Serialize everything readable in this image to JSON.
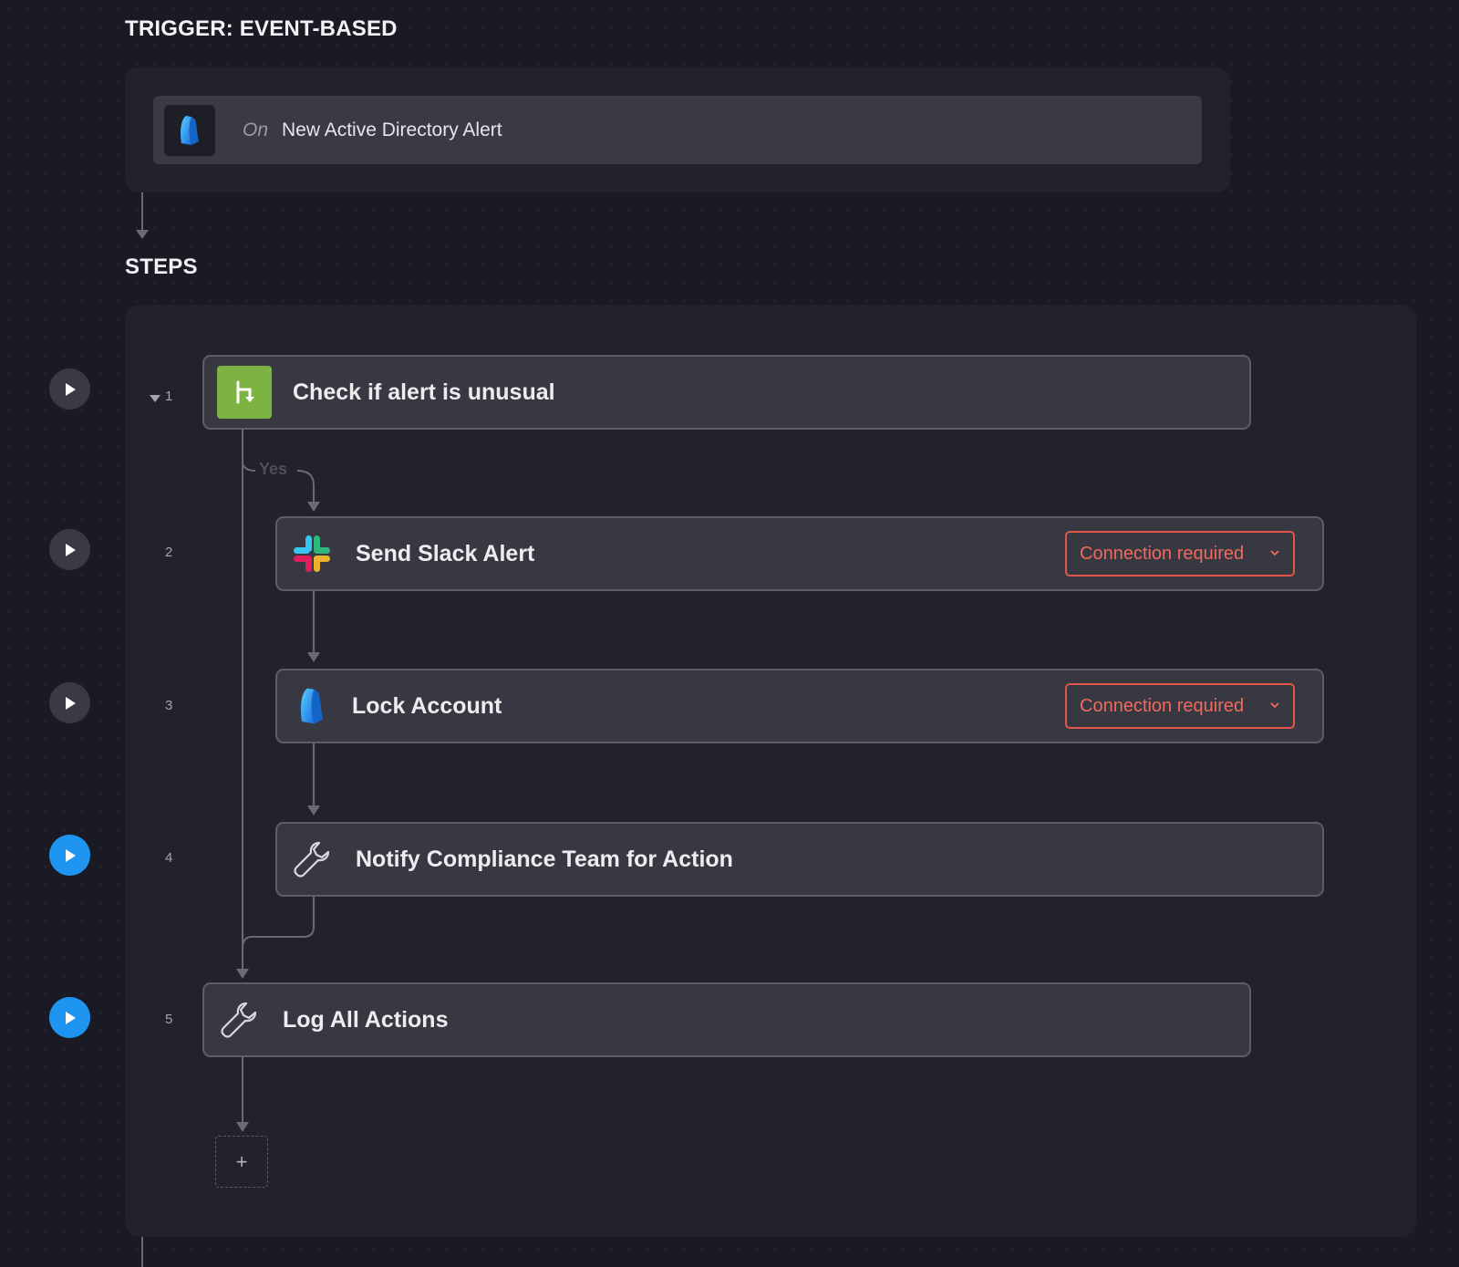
{
  "trigger": {
    "section_title": "TRIGGER: EVENT-BASED",
    "prefix": "On",
    "event_name": "New Active Directory Alert",
    "icon": "active-directory-icon"
  },
  "steps_section": {
    "title": "STEPS",
    "branch_label": "Yes",
    "add_label": "+",
    "steps": [
      {
        "number": "1",
        "label": "Check if alert is unusual",
        "icon": "branch-icon",
        "run_active": false
      },
      {
        "number": "2",
        "label": "Send Slack Alert",
        "icon": "slack-icon",
        "connection": "Connection required",
        "run_active": false
      },
      {
        "number": "3",
        "label": "Lock Account",
        "icon": "active-directory-icon",
        "connection": "Connection required",
        "run_active": false
      },
      {
        "number": "4",
        "label": "Notify Compliance Team for Action",
        "icon": "wrench-icon",
        "run_active": true
      },
      {
        "number": "5",
        "label": "Log All Actions",
        "icon": "wrench-icon",
        "run_active": true
      }
    ]
  },
  "colors": {
    "background": "#1a1a24",
    "accent_blue": "#1e95f0",
    "branch_green": "#7cb342",
    "connection_red": "#e0574a"
  }
}
